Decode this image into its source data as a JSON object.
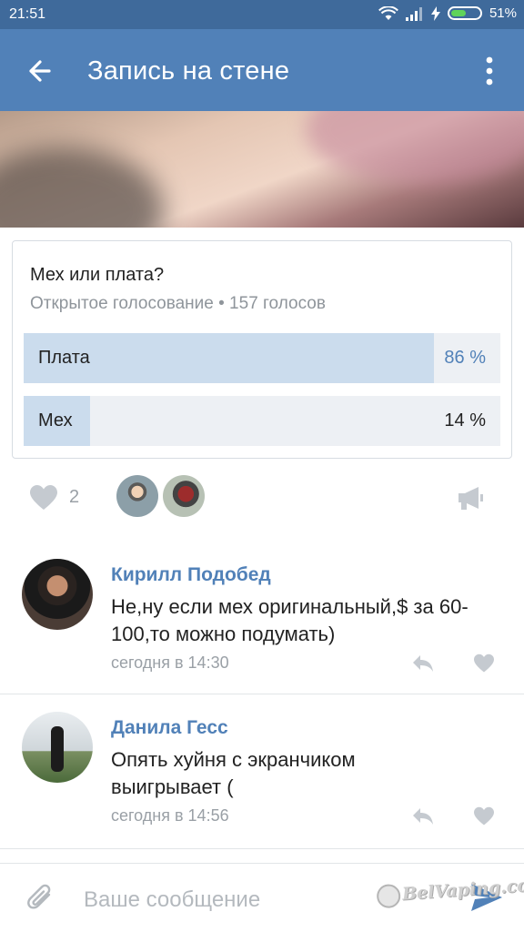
{
  "status_bar": {
    "time": "21:51",
    "battery": "51%"
  },
  "app_bar": {
    "title": "Запись на стене",
    "back_icon": "arrow-left-icon",
    "menu_icon": "more-vertical-icon"
  },
  "poll": {
    "question": "Мех или плата?",
    "meta": "Открытое голосование • 157 голосов",
    "options": [
      {
        "label": "Плата",
        "percent_text": "86 %",
        "fraction": 0.86
      },
      {
        "label": "Мех",
        "percent_text": "14 %",
        "fraction": 0.14
      }
    ]
  },
  "actions": {
    "like_count": "2"
  },
  "comments": [
    {
      "name": "Кирилл Подобед",
      "text": "Не,ну если мех оригинальный,$ за 60-100,то можно подумать)",
      "time": "сегодня в 14:30"
    },
    {
      "name": "Данила Гесс",
      "text": "Опять хуйня с экранчиком выигрывает (",
      "time": "сегодня в 14:56"
    }
  ],
  "composer": {
    "placeholder": "Ваше сообщение",
    "value": ""
  },
  "watermark": {
    "text": "BelVaping.com"
  },
  "colors": {
    "accent": "#5181b8",
    "status_bar": "#3f6a9b",
    "poll_fill": "#cbdced",
    "poll_track": "#edf0f4"
  }
}
